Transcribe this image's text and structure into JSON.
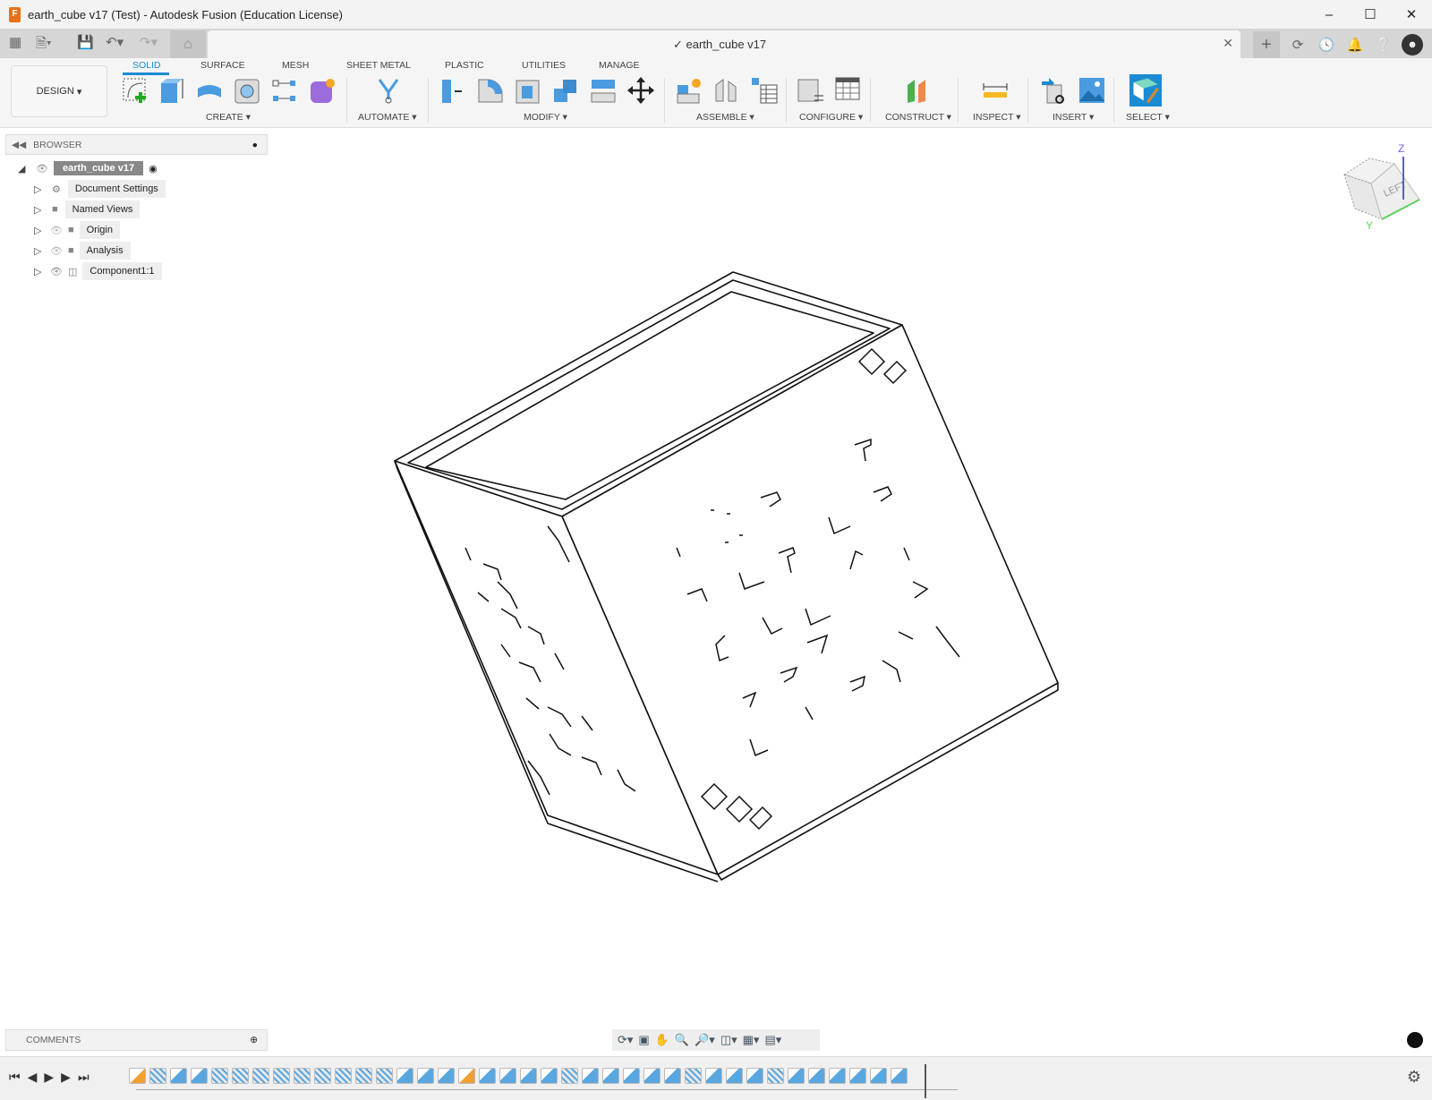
{
  "window": {
    "title": "earth_cube v17 (Test) - Autodesk Fusion (Education License)",
    "logo_letter": "F"
  },
  "doc_tab": {
    "title": "earth_cube v17"
  },
  "workspace": {
    "label": "DESIGN"
  },
  "ribbon": {
    "tabs": [
      "SOLID",
      "SURFACE",
      "MESH",
      "SHEET METAL",
      "PLASTIC",
      "UTILITIES",
      "MANAGE"
    ],
    "groups": [
      "CREATE",
      "AUTOMATE",
      "MODIFY",
      "ASSEMBLE",
      "CONFIGURE",
      "CONSTRUCT",
      "INSPECT",
      "INSERT",
      "SELECT"
    ]
  },
  "browser": {
    "title": "BROWSER",
    "root": "earth_cube v17",
    "items": [
      "Document Settings",
      "Named Views",
      "Origin",
      "Analysis",
      "Component1:1"
    ]
  },
  "comments": {
    "title": "COMMENTS"
  },
  "viewcube": {
    "face": "LEFT",
    "axis_z": "Z",
    "axis_y": "Y"
  },
  "timeline": {
    "features": [
      "s",
      "p",
      "b",
      "b",
      "p",
      "p",
      "p",
      "p",
      "p",
      "p",
      "p",
      "p",
      "p",
      "b",
      "b",
      "b",
      "s",
      "b",
      "b",
      "b",
      "b",
      "p",
      "b",
      "b",
      "b",
      "b",
      "b",
      "p",
      "b",
      "b",
      "b",
      "p",
      "b",
      "b",
      "b",
      "b",
      "b",
      "b"
    ]
  }
}
